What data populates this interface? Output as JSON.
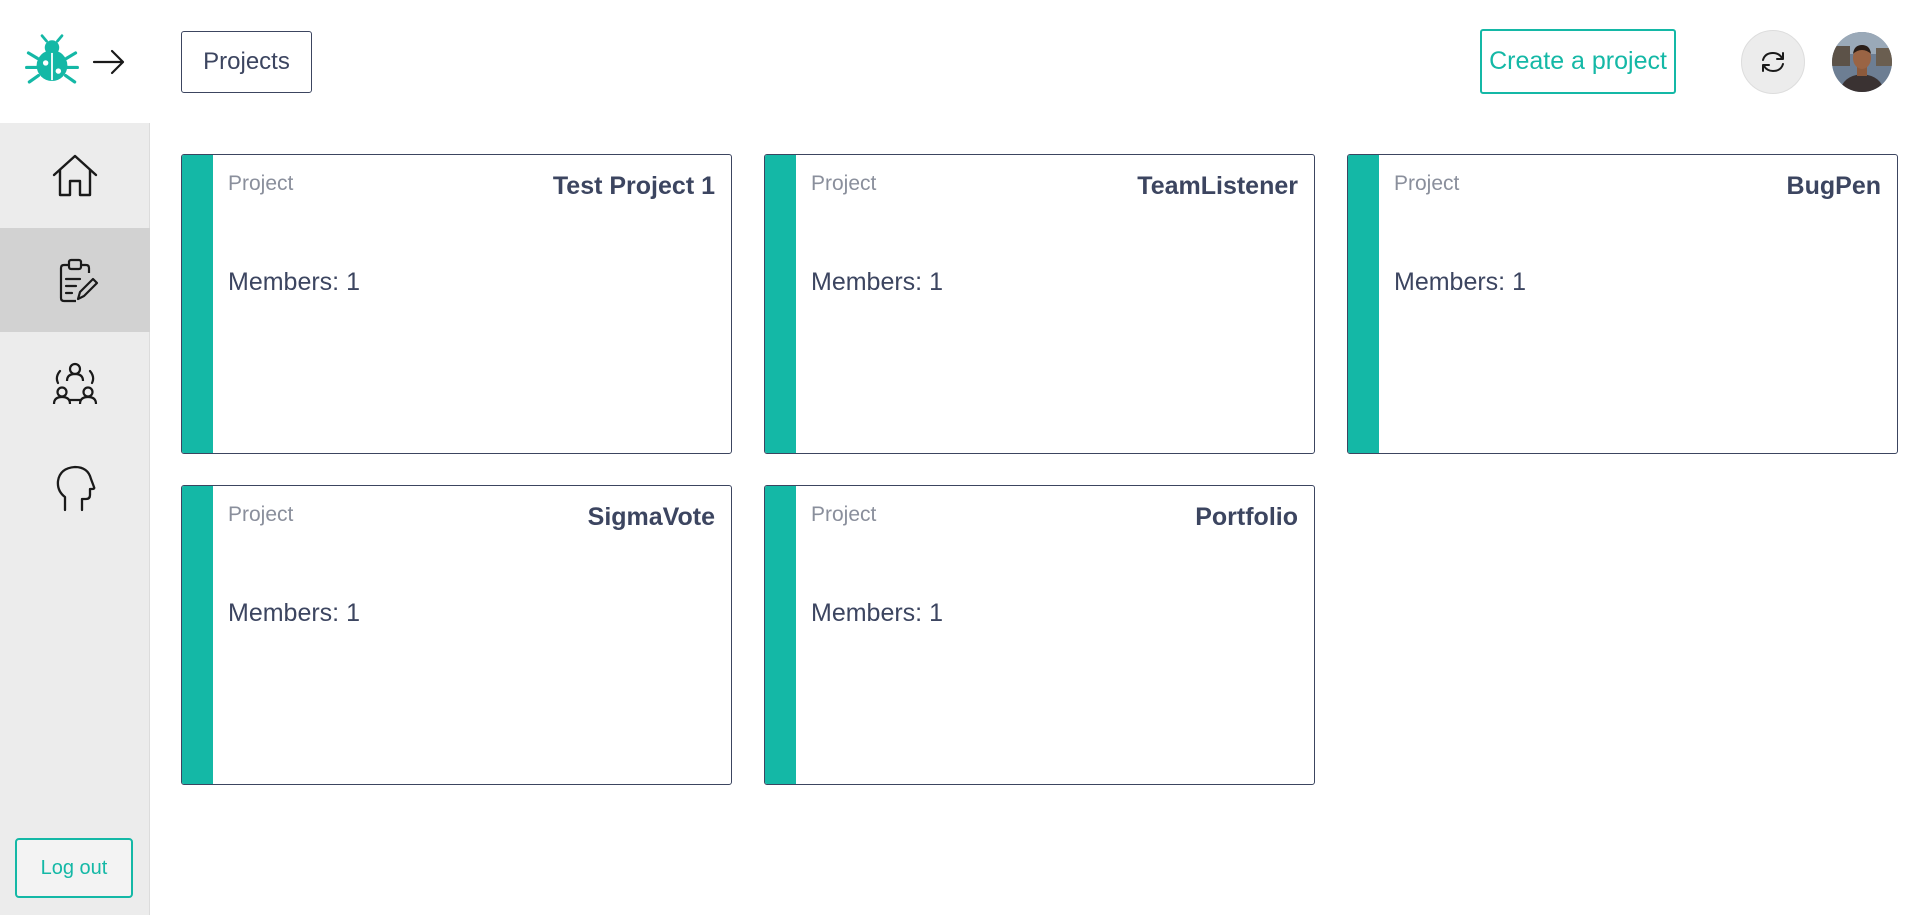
{
  "sidebar": {
    "logout_label": "Log out",
    "nav": [
      {
        "name": "home",
        "icon": "home-icon",
        "active": false
      },
      {
        "name": "projects",
        "icon": "clipboard-edit-icon",
        "active": true
      },
      {
        "name": "teams",
        "icon": "team-icon",
        "active": false
      },
      {
        "name": "profile",
        "icon": "head-profile-icon",
        "active": false
      }
    ]
  },
  "header": {
    "breadcrumb": "Projects",
    "create_label": "Create a project",
    "refresh_icon": "refresh-icon"
  },
  "colors": {
    "accent": "#14b8a6",
    "text": "#3c4560",
    "sidebar_bg": "#ececec",
    "active_nav_bg": "#d2d2d2"
  },
  "projects": [
    {
      "type_label": "Project",
      "title": "Test Project 1",
      "members": "Members: 1"
    },
    {
      "type_label": "Project",
      "title": "TeamListener",
      "members": "Members: 1"
    },
    {
      "type_label": "Project",
      "title": "BugPen",
      "members": "Members: 1"
    },
    {
      "type_label": "Project",
      "title": "SigmaVote",
      "members": "Members: 1"
    },
    {
      "type_label": "Project",
      "title": "Portfolio",
      "members": "Members: 1"
    }
  ]
}
